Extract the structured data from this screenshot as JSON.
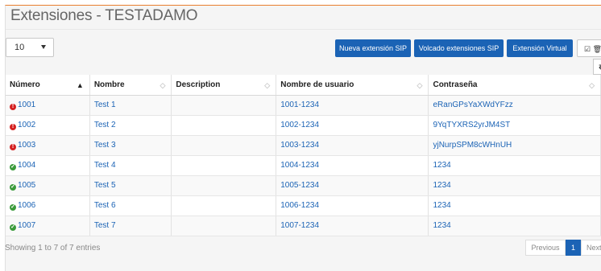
{
  "title": "Extensiones - TESTADAMO",
  "page_size": {
    "value": "10"
  },
  "toolbar": {
    "new_sip": "Nueva extensión SIP",
    "dump_sip": "Volcado extensiones SIP",
    "virtual": "Extensión Virtual",
    "check_trash_icon": "☑ 🗑",
    "swap_icon": "⇄"
  },
  "table": {
    "columns": [
      "Número",
      "Nombre",
      "Description",
      "Nombre de usuario",
      "Contraseña"
    ],
    "rows": [
      {
        "status": "error",
        "number": "1001",
        "name": "Test 1",
        "description": "",
        "username": "1001-1234",
        "password": "eRanGPsYaXWdYFzz"
      },
      {
        "status": "error",
        "number": "1002",
        "name": "Test 2",
        "description": "",
        "username": "1002-1234",
        "password": "9YqTYXRS2yrJM4ST"
      },
      {
        "status": "error",
        "number": "1003",
        "name": "Test 3",
        "description": "",
        "username": "1003-1234",
        "password": "yjNurpSPM8cWHnUH"
      },
      {
        "status": "ok",
        "number": "1004",
        "name": "Test 4",
        "description": "",
        "username": "1004-1234",
        "password": "1234"
      },
      {
        "status": "ok",
        "number": "1005",
        "name": "Test 5",
        "description": "",
        "username": "1005-1234",
        "password": "1234"
      },
      {
        "status": "ok",
        "number": "1006",
        "name": "Test 6",
        "description": "",
        "username": "1006-1234",
        "password": "1234"
      },
      {
        "status": "ok",
        "number": "1007",
        "name": "Test 7",
        "description": "",
        "username": "1007-1234",
        "password": "1234"
      }
    ]
  },
  "footer": {
    "info": "Showing 1 to 7 of 7 entries",
    "previous": "Previous",
    "page": "1",
    "next": "Next"
  }
}
